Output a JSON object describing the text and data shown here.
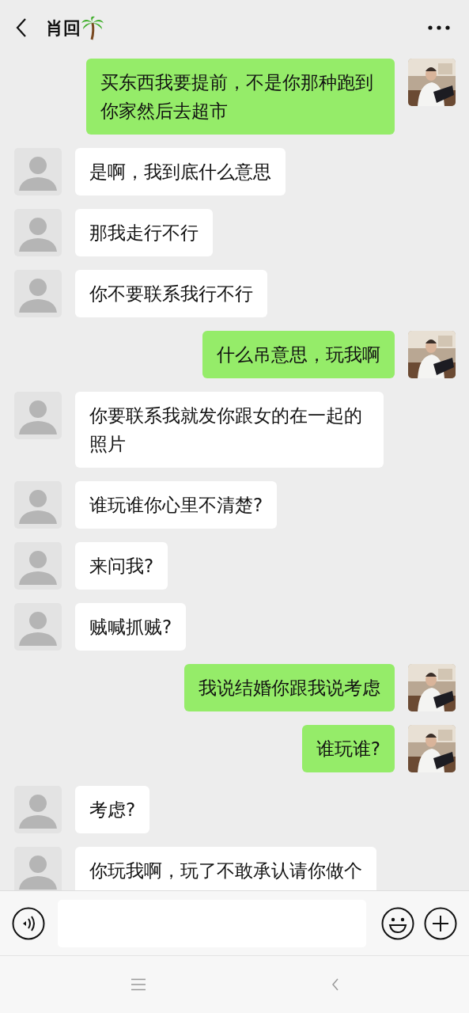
{
  "header": {
    "title": "肖回"
  },
  "messages": [
    {
      "kind": "sent",
      "text": "买东西我要提前，不是你那种跑到你家然后去超市"
    },
    {
      "kind": "received",
      "text": "是啊，我到底什么意思"
    },
    {
      "kind": "received",
      "text": "那我走行不行"
    },
    {
      "kind": "received",
      "text": "你不要联系我行不行"
    },
    {
      "kind": "sent",
      "text": "什么吊意思，玩我啊"
    },
    {
      "kind": "received",
      "text": "你要联系我就发你跟女的在一起的照片"
    },
    {
      "kind": "received",
      "text": "谁玩谁你心里不清楚?"
    },
    {
      "kind": "received",
      "text": "来问我?"
    },
    {
      "kind": "received",
      "text": "贼喊抓贼?"
    },
    {
      "kind": "sent",
      "text": "我说结婚你跟我说考虑"
    },
    {
      "kind": "sent",
      "text": "谁玩谁?"
    },
    {
      "kind": "received",
      "text": "考虑?"
    },
    {
      "kind": "received",
      "text": "你玩我啊，玩了不敢承认请你做个"
    }
  ]
}
